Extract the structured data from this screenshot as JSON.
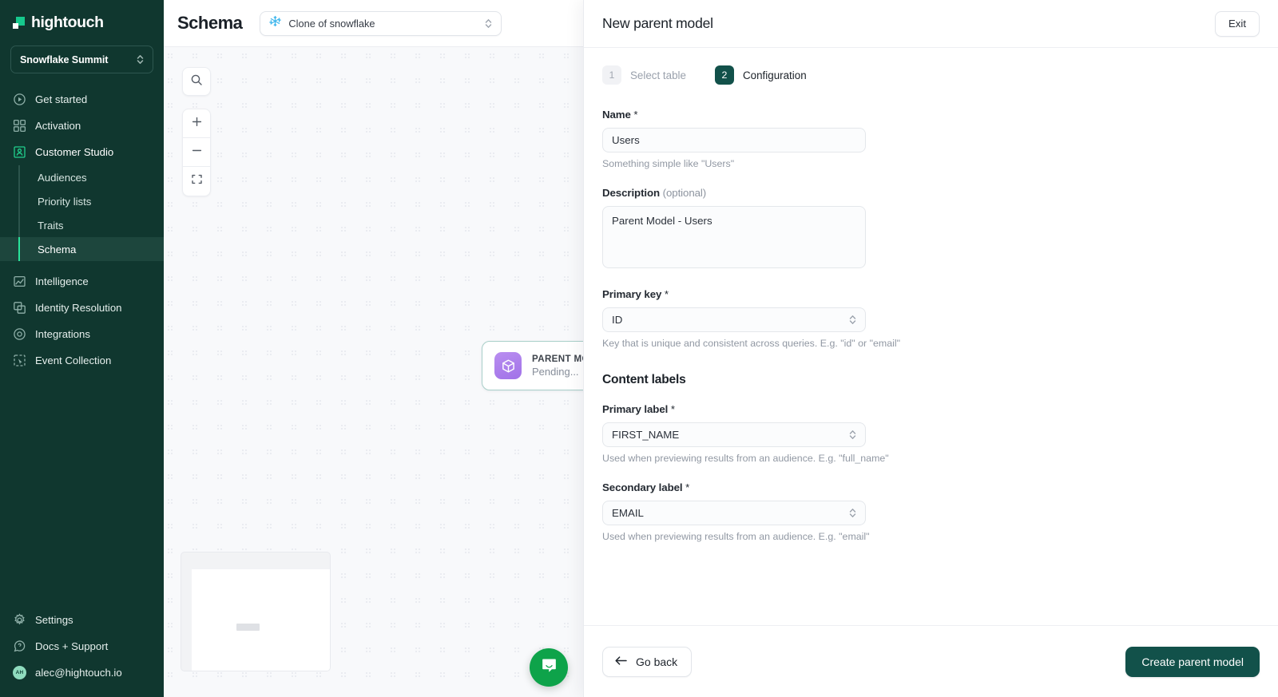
{
  "sidebar": {
    "logo_text": "hightouch",
    "workspace": "Snowflake Summit",
    "items": [
      {
        "label": "Get started",
        "icon": "play-circle-icon"
      },
      {
        "label": "Activation",
        "icon": "grid-squares-icon"
      },
      {
        "label": "Customer Studio",
        "icon": "customer-studio-icon"
      }
    ],
    "sub_items": [
      {
        "label": "Audiences"
      },
      {
        "label": "Priority lists"
      },
      {
        "label": "Traits"
      },
      {
        "label": "Schema"
      }
    ],
    "items_after": [
      {
        "label": "Intelligence",
        "icon": "chart-icon"
      },
      {
        "label": "Identity Resolution",
        "icon": "identity-icon"
      },
      {
        "label": "Integrations",
        "icon": "integrations-icon"
      },
      {
        "label": "Event Collection",
        "icon": "event-collection-icon"
      }
    ],
    "bottom_items": [
      {
        "label": "Settings",
        "icon": "gear-icon"
      },
      {
        "label": "Docs + Support",
        "icon": "question-circle-icon"
      }
    ],
    "user": {
      "email": "alec@hightouch.io",
      "initials": "AH"
    },
    "active_item": "Schema",
    "accent_color": "#2ae39b",
    "background_color": "#10372f"
  },
  "canvas": {
    "page_title": "Schema",
    "source_select_value": "Clone of snowflake",
    "source_icon": "snowflake-icon",
    "controls": {
      "search": "search-icon",
      "zoom_in": "plus-icon",
      "zoom_out": "minus-icon",
      "fit_view": "fit-screen-icon"
    },
    "node": {
      "title": "PARENT MODEL",
      "status": "Pending...",
      "icon": "cube-icon",
      "icon_color": "#a172e8"
    },
    "chat_icon": "chat-bubble-icon",
    "chat_color": "#0ea34a"
  },
  "panel": {
    "title": "New parent model",
    "exit_label": "Exit",
    "steps": [
      {
        "number": "1",
        "label": "Select table",
        "active": false
      },
      {
        "number": "2",
        "label": "Configuration",
        "active": true
      }
    ],
    "name_field": {
      "label": "Name",
      "required_mark": " *",
      "value": "Users",
      "placeholder": "Users",
      "help": "Something simple like \"Users\""
    },
    "description_field": {
      "label": "Description",
      "optional_mark": "(optional)",
      "value": "Parent Model - Users",
      "placeholder": "Description"
    },
    "primary_key_field": {
      "label": "Primary key",
      "required_mark": " *",
      "value": "ID",
      "help": "Key that is unique and consistent across queries. E.g. \"id\" or \"email\""
    },
    "content_labels_heading": "Content labels",
    "primary_label_field": {
      "label": "Primary label",
      "required_mark": " *",
      "value": "FIRST_NAME",
      "help": "Used when previewing results from an audience. E.g. \"full_name\""
    },
    "secondary_label_field": {
      "label": "Secondary label",
      "required_mark": " *",
      "value": "EMAIL",
      "help": "Used when previewing results from an audience. E.g. \"email\""
    },
    "footer": {
      "go_back_label": "Go back",
      "create_label": "Create parent model",
      "back_icon": "arrow-left-icon",
      "primary_color": "#12514a"
    }
  }
}
